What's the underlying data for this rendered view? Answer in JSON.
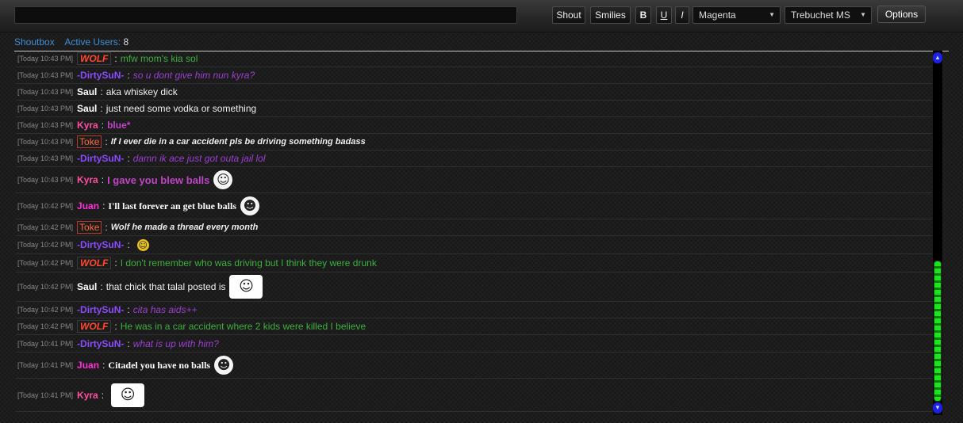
{
  "toolbar": {
    "shout_input_value": "",
    "shout_label": "Shout",
    "smilies_label": "Smilies",
    "bold_label": "B",
    "underline_label": "U",
    "italic_label": "I",
    "color_value": "Magenta",
    "font_value": "Trebuchet MS",
    "options_label": "Options"
  },
  "tabs": {
    "shoutbox_label": "Shoutbox",
    "active_users_label": "Active Users:",
    "active_users_count": "8"
  },
  "messages": [
    {
      "time": "[Today 10:43 PM]",
      "author": "WOLF",
      "text": "mfw mom's kia sol"
    },
    {
      "time": "[Today 10:43 PM]",
      "author": "-DirtySuN-",
      "text": "so u dont give him nun kyra?"
    },
    {
      "time": "[Today 10:43 PM]",
      "author": "Saul",
      "text": "aka whiskey dick"
    },
    {
      "time": "[Today 10:43 PM]",
      "author": "Saul",
      "text": "just need some vodka or something"
    },
    {
      "time": "[Today 10:43 PM]",
      "author": "Kyra",
      "text": "blue*"
    },
    {
      "time": "[Today 10:43 PM]",
      "author": "Toke",
      "text": "If I ever die in a car accident pls be driving something badass"
    },
    {
      "time": "[Today 10:43 PM]",
      "author": "-DirtySuN-",
      "text": "damn ik ace just got outa jail lol"
    },
    {
      "time": "[Today 10:43 PM]",
      "author": "Kyra",
      "text": "I gave you blew balls"
    },
    {
      "time": "[Today 10:42 PM]",
      "author": "Juan",
      "text": "I'll last forever an get blue balls"
    },
    {
      "time": "[Today 10:42 PM]",
      "author": "Toke",
      "text": "Wolf he made a thread every month"
    },
    {
      "time": "[Today 10:42 PM]",
      "author": "-DirtySuN-",
      "text": ""
    },
    {
      "time": "[Today 10:42 PM]",
      "author": "WOLF",
      "text": "I don't remember who was driving but I think they were drunk"
    },
    {
      "time": "[Today 10:42 PM]",
      "author": "Saul",
      "text": "that chick that talal posted is"
    },
    {
      "time": "[Today 10:42 PM]",
      "author": "-DirtySuN-",
      "text": "cita has aids++"
    },
    {
      "time": "[Today 10:42 PM]",
      "author": "WOLF",
      "text": "He was in a car accident where 2 kids were killed I believe"
    },
    {
      "time": "[Today 10:41 PM]",
      "author": "-DirtySuN-",
      "text": "what is up with him?"
    },
    {
      "time": "[Today 10:41 PM]",
      "author": "Juan",
      "text": "Citadel you have no balls"
    },
    {
      "time": "[Today 10:41 PM]",
      "author": "Kyra",
      "text": ""
    }
  ],
  "colors": {
    "wolf": "#ff4a2a",
    "dirtysun": "#8a4cff",
    "kyra": "#ff4fa0",
    "juan": "#ff2fd8",
    "toke": "#ff6a3a",
    "scroll_thumb": "#1ee41e",
    "scroll_arrows": "#1a20e6",
    "tab_link": "#3f8fd6"
  },
  "icons": {
    "color_dropdown": "chevron-down-icon",
    "font_dropdown": "chevron-down-icon",
    "emote": "smiley-icon"
  }
}
